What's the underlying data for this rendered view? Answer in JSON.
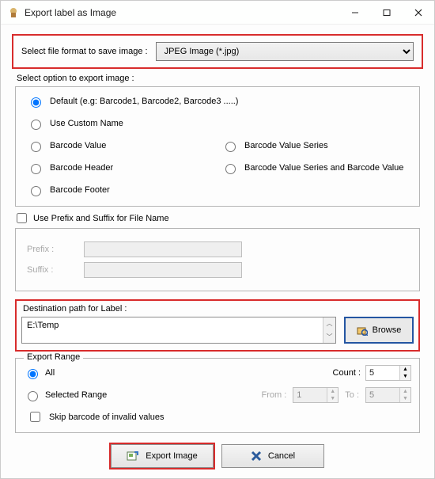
{
  "window": {
    "title": "Export label as Image"
  },
  "format": {
    "label": "Select file format to save image :",
    "selected": "JPEG Image (*.jpg)"
  },
  "options": {
    "label": "Select option to export image :",
    "default": "Default (e.g: Barcode1, Barcode2, Barcode3 .....)",
    "custom_name": "Use Custom Name",
    "barcode_value": "Barcode Value",
    "barcode_value_series": "Barcode Value Series",
    "barcode_header": "Barcode Header",
    "series_and_value": "Barcode Value Series and Barcode Value",
    "barcode_footer": "Barcode Footer",
    "selected": "default"
  },
  "prefix_suffix": {
    "checkbox_label": "Use Prefix and Suffix for File Name",
    "prefix_label": "Prefix :",
    "suffix_label": "Suffix :",
    "prefix_value": "",
    "suffix_value": ""
  },
  "destination": {
    "label": "Destination path for Label :",
    "path": "E:\\Temp",
    "browse_label": "Browse"
  },
  "export_range": {
    "legend": "Export Range",
    "all_label": "All",
    "selected_range_label": "Selected Range",
    "count_label": "Count :",
    "from_label": "From :",
    "to_label": "To :",
    "count_value": "5",
    "from_value": "1",
    "to_value": "5",
    "skip_label": "Skip barcode of invalid values",
    "selected": "all"
  },
  "buttons": {
    "export": "Export Image",
    "cancel": "Cancel"
  }
}
